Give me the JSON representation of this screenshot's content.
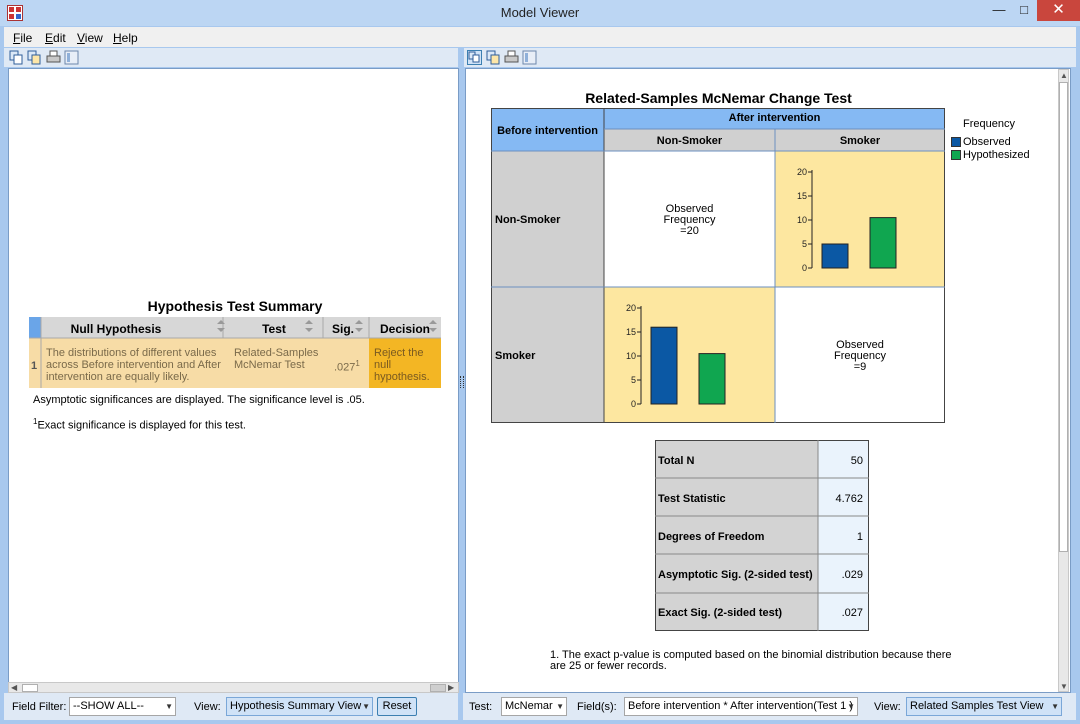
{
  "window": {
    "title": "Model Viewer",
    "min": "▭",
    "max": "□",
    "close": "✕"
  },
  "menu": [
    {
      "label": "File",
      "u": "F",
      "rest": "ile"
    },
    {
      "label": "Edit",
      "u": "E",
      "rest": "dit"
    },
    {
      "label": "View",
      "u": "V",
      "rest": "iew"
    },
    {
      "label": "Help",
      "u": "H",
      "rest": "elp"
    }
  ],
  "icons": [
    "copy-icon",
    "copy-special-icon",
    "print-icon",
    "pivot-icon"
  ],
  "left": {
    "title": "Hypothesis Test Summary",
    "headers": [
      "Null Hypothesis",
      "Test",
      "Sig.",
      "Decision"
    ],
    "row": {
      "num": "1",
      "hypothesis": "The distributions of different values across Before intervention and After intervention are equally likely.",
      "test": "Related-Samples McNemar Test",
      "sig": ".027",
      "sig_sup": "1",
      "decision": "Reject the null hypothesis."
    },
    "note1": "Asymptotic significances are displayed.  The significance level is .05.",
    "note2_sup": "1",
    "note2": "Exact significance is displayed for this test.",
    "status": {
      "field_filter_label": "Field Filter:",
      "field_filter_u": "l",
      "field_filter_value": "--SHOW ALL--",
      "view_label": "View:",
      "view_u": "V",
      "view_value": "Hypothesis Summary View",
      "reset": "Reset"
    }
  },
  "right": {
    "title": "Related-Samples McNemar Change Test",
    "row_header": "Before intervention",
    "col_header": "After intervention",
    "col_labels": [
      "Non-Smoker",
      "Smoker"
    ],
    "row_labels": [
      "Non-Smoker",
      "Smoker"
    ],
    "legend": {
      "title": "Frequency",
      "observed": "Observed",
      "hypothesized": "Hypothesized",
      "observed_color": "#0b58a4",
      "hypothesized_color": "#10a650"
    },
    "cells": {
      "nn": {
        "l1": "Observed",
        "l2": "Frequency",
        "l3": "=20"
      },
      "ss": {
        "l1": "Observed",
        "l2": "Frequency",
        "l3": "=9"
      }
    },
    "stats": [
      {
        "label": "Total N",
        "value": "50"
      },
      {
        "label": "Test Statistic",
        "value": "4.762"
      },
      {
        "label": "Degrees of Freedom",
        "value": "1"
      },
      {
        "label": "Asymptotic Sig. (2-sided test)",
        "value": ".029"
      },
      {
        "label": "Exact Sig. (2-sided test)",
        "value": ".027"
      }
    ],
    "footnote_l1": "1.  The exact p-value is computed based on the binomial distribution because there",
    "footnote_l2": "are 25 or fewer records.",
    "status": {
      "test_label": "Test:",
      "test_value": "McNemar",
      "fields_label": "Field(s):",
      "fields_value": "Before intervention * After intervention(Test 1 )",
      "view_label": "View:",
      "view_value": "Related Samples Test View"
    }
  },
  "chart_data": [
    {
      "type": "bar",
      "title": "",
      "categories": [
        "Observed",
        "Hypothesized"
      ],
      "values": [
        5,
        10.5
      ],
      "ylim": [
        0,
        20
      ],
      "yticks": [
        0,
        5,
        10,
        15,
        20
      ],
      "cell": "Before Non-Smoker / After Smoker"
    },
    {
      "type": "bar",
      "title": "",
      "categories": [
        "Observed",
        "Hypothesized"
      ],
      "values": [
        16,
        10.5
      ],
      "ylim": [
        0,
        20
      ],
      "yticks": [
        0,
        5,
        10,
        15,
        20
      ],
      "cell": "Before Smoker / After Non-Smoker"
    }
  ]
}
